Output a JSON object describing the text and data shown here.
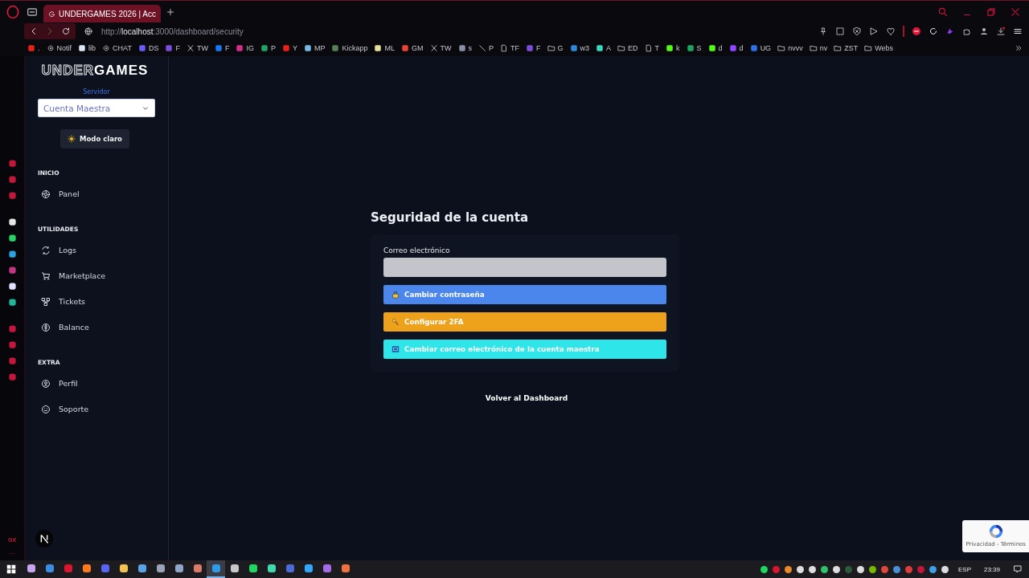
{
  "browser": {
    "tab": {
      "title": "UNDERGAMES 2026 | Acc",
      "selected": true
    },
    "url": {
      "scheme": "http://",
      "host": "localhost",
      "path": ":3000/dashboard/security"
    },
    "bookmarks": [
      {
        "label": ".",
        "kind": "site",
        "color": "#e62117"
      },
      {
        "label": "Notif",
        "kind": "gear"
      },
      {
        "label": "lib",
        "kind": "site",
        "color": "#dfe6f5"
      },
      {
        "label": "CHAT",
        "kind": "gear"
      },
      {
        "label": "DS",
        "kind": "site",
        "color": "#6a5cf5"
      },
      {
        "label": "F",
        "kind": "site",
        "color": "#7c4ddb"
      },
      {
        "label": "TW",
        "kind": "x"
      },
      {
        "label": "F",
        "kind": "site",
        "color": "#1877f2"
      },
      {
        "label": "IG",
        "kind": "site",
        "color": "#d62f87"
      },
      {
        "label": "P",
        "kind": "site",
        "color": "#1fa463"
      },
      {
        "label": "Y",
        "kind": "site",
        "color": "#e62117"
      },
      {
        "label": "MP",
        "kind": "site",
        "color": "#7ab8e8"
      },
      {
        "label": "Kickapp",
        "kind": "site",
        "color": "#5a7f58"
      },
      {
        "label": "ML",
        "kind": "site",
        "color": "#e8e0a0"
      },
      {
        "label": "GM",
        "kind": "site",
        "color": "#ea4335"
      },
      {
        "label": "TW",
        "kind": "x"
      },
      {
        "label": "s",
        "kind": "site",
        "color": "#8a8fa8"
      },
      {
        "label": "P",
        "kind": "slash"
      },
      {
        "label": "TF",
        "kind": "page"
      },
      {
        "label": "F",
        "kind": "site",
        "color": "#7c4ddb"
      },
      {
        "label": "G",
        "kind": "folder"
      },
      {
        "label": "w3",
        "kind": "site",
        "color": "#2d8ad8"
      },
      {
        "label": "A",
        "kind": "site",
        "color": "#3dd6c0"
      },
      {
        "label": "ED",
        "kind": "folder"
      },
      {
        "label": "T",
        "kind": "page"
      },
      {
        "label": "k",
        "kind": "site",
        "color": "#53fc18"
      },
      {
        "label": "S",
        "kind": "site",
        "color": "#1fa463"
      },
      {
        "label": "d",
        "kind": "site",
        "color": "#53fc18"
      },
      {
        "label": "d",
        "kind": "site",
        "color": "#9146ff"
      },
      {
        "label": "UG",
        "kind": "site",
        "color": "#2f6fe8"
      },
      {
        "label": "nvvv",
        "kind": "folder"
      },
      {
        "label": "nv",
        "kind": "folder"
      },
      {
        "label": "ZST",
        "kind": "folder"
      },
      {
        "label": "Webs",
        "kind": "folder"
      }
    ]
  },
  "opera_sidebar": {
    "icons": [
      {
        "color": "#c4163a"
      },
      {
        "color": "#c4163a"
      },
      {
        "color": "#c4163a"
      },
      {
        "color": "#e6e6e6"
      },
      {
        "color": "#25d366"
      },
      {
        "color": "#2aa3e0"
      },
      {
        "color": "#c13584"
      },
      {
        "color": "#dfe3ff"
      },
      {
        "color": "#1fb89a"
      },
      {
        "color": "#c4163a"
      },
      {
        "color": "#c4163a"
      },
      {
        "color": "#c4163a"
      },
      {
        "color": "#c4163a"
      }
    ],
    "badge": "GX",
    "more": "···"
  },
  "sidebar": {
    "logo": {
      "outline": "UNDER",
      "solid": "GAMES"
    },
    "server": {
      "label": "Servidor",
      "value": "Cuenta Maestra"
    },
    "theme_button": "Modo claro",
    "sections": [
      {
        "title": "INICIO",
        "items": [
          {
            "label": "Panel",
            "selected": false
          }
        ]
      },
      {
        "title": "UTILIDADES",
        "items": [
          {
            "label": "Logs",
            "selected": false
          },
          {
            "label": "Marketplace",
            "selected": false
          },
          {
            "label": "Tickets",
            "selected": false
          },
          {
            "label": "Balance",
            "selected": false
          }
        ]
      },
      {
        "title": "EXTRA",
        "items": [
          {
            "label": "Perfil",
            "selected": false
          },
          {
            "label": "Soporte",
            "selected": false
          }
        ]
      }
    ]
  },
  "main": {
    "title": "Seguridad de la cuenta",
    "email": {
      "label": "Correo electrónico"
    },
    "buttons": [
      {
        "label": "Cambiar contraseña",
        "kind": "lock",
        "color": "#4a86ec"
      },
      {
        "label": "Configurar 2FA",
        "kind": "key",
        "color": "#eea21c"
      },
      {
        "label": "Cambiar correo electrónico de la cuenta maestra",
        "kind": "mail",
        "color": "#2ee6e9"
      }
    ],
    "back_link": "Volver al Dashboard"
  },
  "recaptcha": {
    "text": "Privacidad - Términos"
  },
  "taskbar": {
    "apps": [
      {
        "color": "#c9a5f0",
        "selected": false
      },
      {
        "color": "#3a8ee6",
        "selected": false
      },
      {
        "color": "#d9162e",
        "selected": false
      },
      {
        "color": "#ff7a1a",
        "selected": false
      },
      {
        "color": "#5865f2",
        "selected": false
      },
      {
        "color": "#f2c14e",
        "selected": false
      },
      {
        "color": "#5aa2e6",
        "selected": false
      },
      {
        "color": "#9aa4b8",
        "selected": false
      },
      {
        "color": "#8fa6c8",
        "selected": false
      },
      {
        "color": "#d97a6a",
        "selected": false
      },
      {
        "color": "#2f9be8",
        "selected": true
      },
      {
        "color": "#c8c8c8",
        "selected": false
      },
      {
        "color": "#1ed760",
        "selected": false
      },
      {
        "color": "#3ddbb0",
        "selected": false
      },
      {
        "color": "#4b6bd8",
        "selected": false
      },
      {
        "color": "#31a8ff",
        "selected": false
      },
      {
        "color": "#a86be8",
        "selected": false
      },
      {
        "color": "#f07040",
        "selected": false
      }
    ],
    "tray": [
      {
        "color": "#1ed760"
      },
      {
        "color": "#d9162e"
      },
      {
        "color": "#ea8a2a"
      },
      {
        "color": "#dddddd"
      },
      {
        "color": "#dddddd"
      },
      {
        "color": "#2fc26b"
      },
      {
        "color": "#dddddd"
      },
      {
        "color": "#2c5a3a"
      },
      {
        "color": "#dddddd"
      },
      {
        "color": "#76b900"
      },
      {
        "color": "#e0473a"
      },
      {
        "color": "#4a90d9"
      },
      {
        "color": "#e03c3c"
      },
      {
        "color": "#c4163a"
      },
      {
        "color": "#3ca0e8"
      },
      {
        "color": "#dddddd"
      }
    ],
    "language": "ESP",
    "time": "23:39"
  }
}
